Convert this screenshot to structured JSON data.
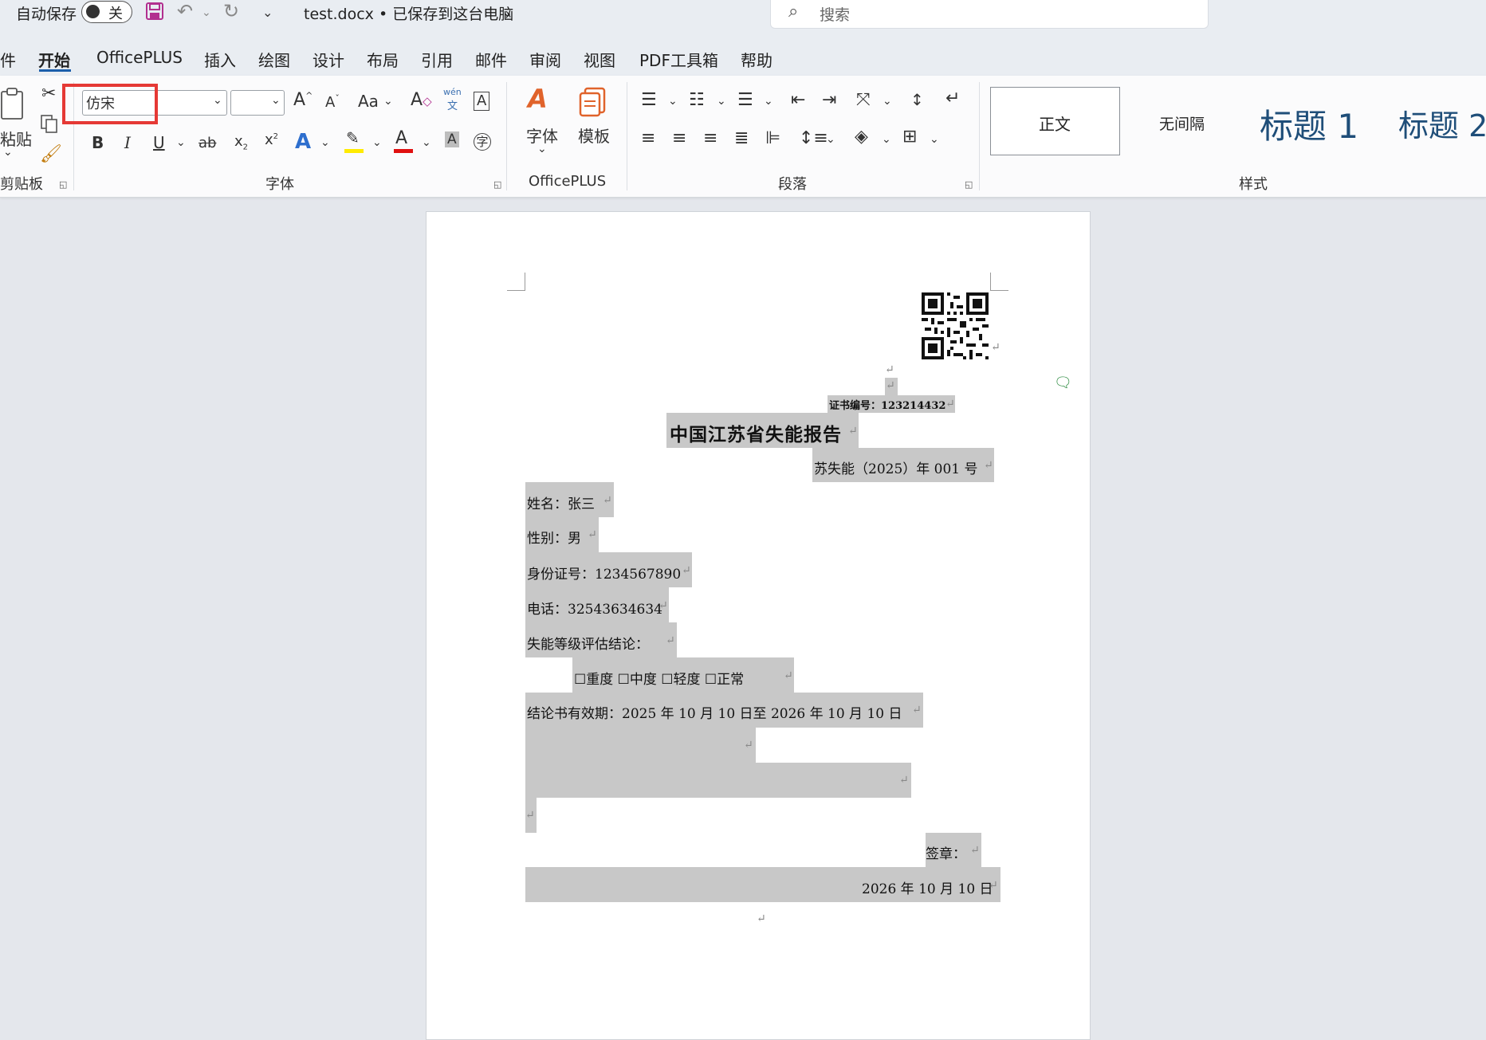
{
  "titlebar": {
    "autosave_label": "自动保存",
    "autosave_state": "关",
    "filename": "test.docx • 已保存到这台电脑",
    "search_placeholder": "搜索"
  },
  "tabs": [
    "件",
    "开始",
    "OfficePLUS",
    "插入",
    "绘图",
    "设计",
    "布局",
    "引用",
    "邮件",
    "审阅",
    "视图",
    "PDF工具箱",
    "帮助"
  ],
  "ribbon": {
    "clipboard": {
      "paste_label": "粘贴",
      "group_label": "剪贴板"
    },
    "font": {
      "font_name": "仿宋",
      "font_size": "",
      "group_label": "字体",
      "change_case": "Aa",
      "phonetic_top": "wén",
      "phonetic_bottom": "文",
      "enclose": "字"
    },
    "officeplus": {
      "font_btn": "字体",
      "template_btn": "模板",
      "group_label": "OfficePLUS"
    },
    "paragraph": {
      "group_label": "段落"
    },
    "styles": {
      "items": [
        "正文",
        "无间隔",
        "标题 1",
        "标题 2"
      ],
      "group_label": "样式"
    }
  },
  "document": {
    "cert_no": "证书编号：123214432",
    "title": "中国江苏省失能报告",
    "doc_no": "苏失能（2025）年 001 号",
    "name": "姓名：张三",
    "gender": "性别：男",
    "id_no": "身份证号：1234567890",
    "phone": "电话：32543634634",
    "conclusion_label": "失能等级评估结论：",
    "levels": "☐重度 ☐中度 ☐轻度 ☐正常",
    "validity": "结论书有效期：2025 年 10 月 10 日至 2026 年 10 月 10 日",
    "seal": "签章：",
    "date": "2026 年 10 月 10 日",
    "para_mark": "↵"
  },
  "colors": {
    "accent": "#1b5eab",
    "highlight": "#c8c8c8",
    "callout": "#e53935"
  }
}
